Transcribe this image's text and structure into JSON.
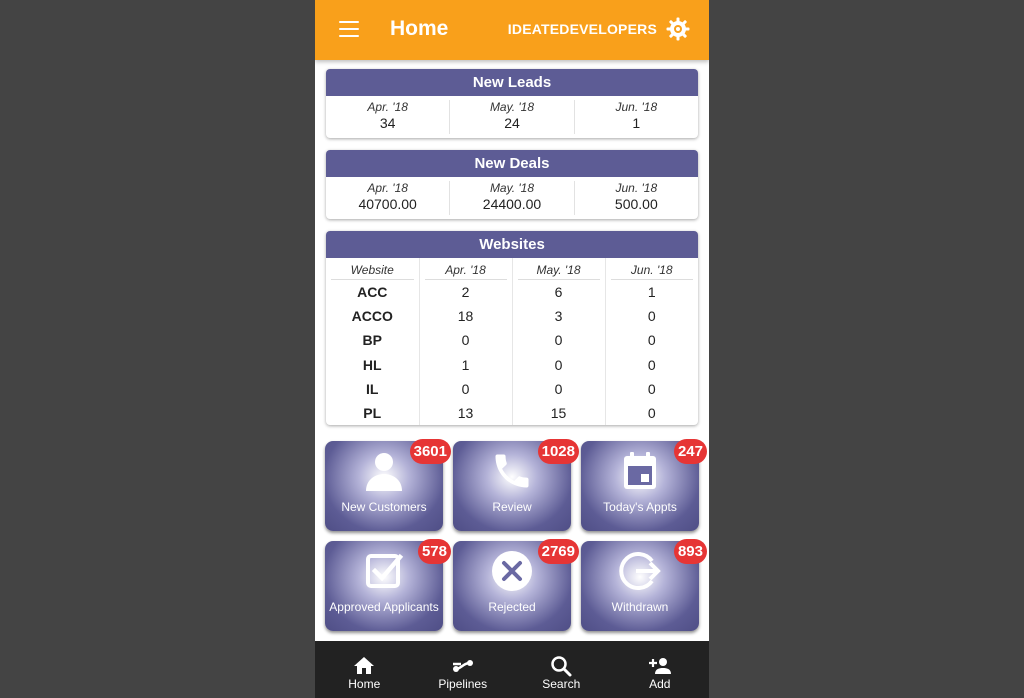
{
  "app": {
    "title": "Home",
    "org_name": "IDEATEDEVELOPERS"
  },
  "icons": {
    "menu": "hamburger-menu-icon",
    "settings": "gear-icon"
  },
  "colors": {
    "appbar": "#f9a01b",
    "card_header": "#5d5c95",
    "badge": "#e63535",
    "bottom_nav": "#222222"
  },
  "new_leads": {
    "title": "New Leads",
    "items": [
      {
        "month": "Apr. '18",
        "value": "34"
      },
      {
        "month": "May. '18",
        "value": "24"
      },
      {
        "month": "Jun. '18",
        "value": "1"
      }
    ]
  },
  "new_deals": {
    "title": "New Deals",
    "items": [
      {
        "month": "Apr. '18",
        "value": "40700.00"
      },
      {
        "month": "May. '18",
        "value": "24400.00"
      },
      {
        "month": "Jun. '18",
        "value": "500.00"
      }
    ]
  },
  "websites": {
    "title": "Websites",
    "columns": [
      "Website",
      "Apr. '18",
      "May. '18",
      "Jun. '18"
    ],
    "rows": [
      [
        "ACC",
        "2",
        "6",
        "1"
      ],
      [
        "ACCO",
        "18",
        "3",
        "0"
      ],
      [
        "BP",
        "0",
        "0",
        "0"
      ],
      [
        "HL",
        "1",
        "0",
        "0"
      ],
      [
        "IL",
        "0",
        "0",
        "0"
      ],
      [
        "PL",
        "13",
        "15",
        "0"
      ]
    ]
  },
  "tiles": [
    {
      "label": "New Customers",
      "badge": "3601",
      "icon": "person-icon"
    },
    {
      "label": "Review",
      "badge": "1028",
      "icon": "phone-icon"
    },
    {
      "label": "Today's Appts",
      "badge": "247",
      "icon": "calendar-icon"
    },
    {
      "label": "Approved Applicants",
      "badge": "578",
      "icon": "checkbox-icon"
    },
    {
      "label": "Rejected",
      "badge": "2769",
      "icon": "cancel-circle-icon"
    },
    {
      "label": "Withdrawn",
      "badge": "893",
      "icon": "exit-arrow-icon"
    }
  ],
  "bottom_nav": [
    {
      "label": "Home",
      "icon": "home-icon"
    },
    {
      "label": "Pipelines",
      "icon": "pipeline-icon"
    },
    {
      "label": "Search",
      "icon": "search-icon"
    },
    {
      "label": "Add",
      "icon": "add-person-icon"
    }
  ]
}
